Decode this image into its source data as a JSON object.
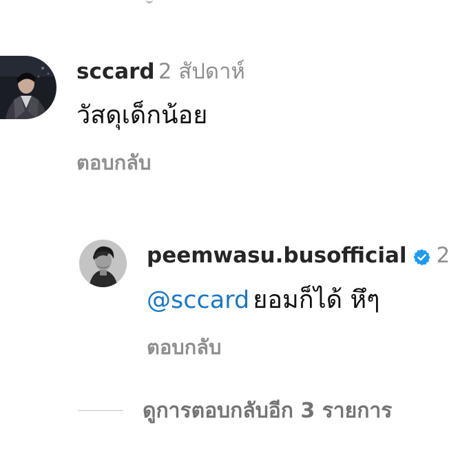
{
  "comment": {
    "username": "sccard",
    "time_ago": "2 สัปดาห์",
    "text": "วัสดุเด็กน้อย",
    "reply_label": "ตอบกลับ",
    "avatar_icon": "profile-photo-dark-jacket"
  },
  "reply": {
    "username": "peemwasu.busofficial",
    "verified_icon": "verified-badge-icon",
    "time_ago": "2",
    "mention": "@sccard",
    "text": "ยอมก็ได้ หึๆ",
    "reply_label": "ตอบกลับ",
    "avatar_icon": "profile-photo-grayscale-portrait"
  },
  "view_more": {
    "label": "ดูการตอบกลับอีก 3 รายการ"
  },
  "colors": {
    "mention": "#1877c9",
    "verified": "#1d9bf0",
    "secondary_text": "#8e8e8e",
    "primary_text": "#262626"
  }
}
